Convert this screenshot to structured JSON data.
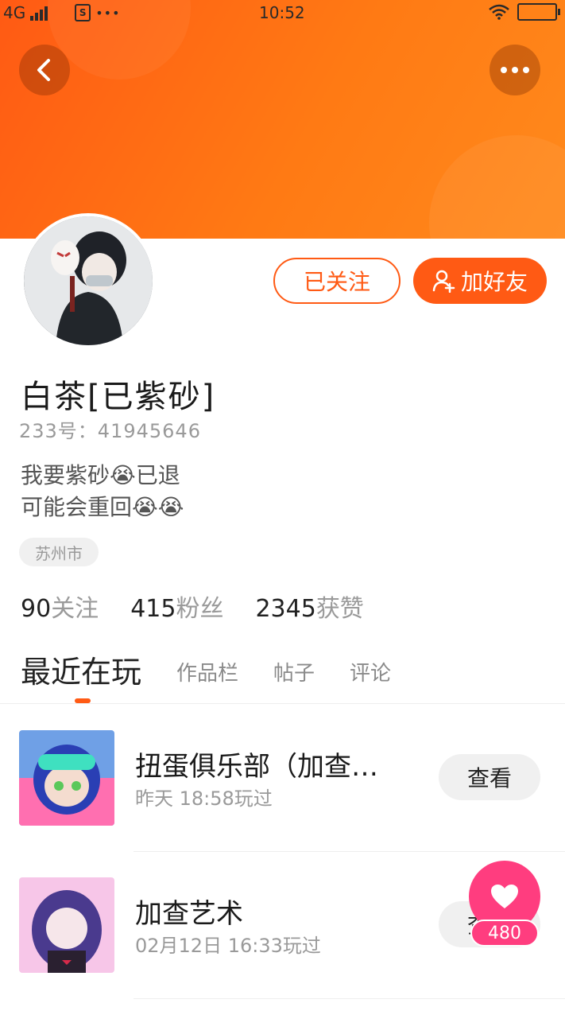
{
  "status_bar": {
    "network": "4G",
    "sim_label": "S",
    "more": "•••",
    "time": "10:52"
  },
  "colors": {
    "accent": "#ff5a14",
    "banner_start": "#ff5a14",
    "banner_end": "#ff8a1c",
    "favorite": "#ff3d7f"
  },
  "icons": {
    "back": "chevron-left-icon",
    "more": "more-dots-icon",
    "add_friend": "add-user-icon",
    "favorite": "heart-icon",
    "wifi": "wifi-icon",
    "battery": "battery-icon",
    "signal": "signal-icon"
  },
  "profile": {
    "name": "白茶[已紫砂]",
    "uid": "233号：41945646",
    "bio_line1": "我要紫砂😭已退",
    "bio_line2": "可能会重回😭😭",
    "location": "苏州市"
  },
  "actions": {
    "following_label": "已关注",
    "add_friend_label": "加好友"
  },
  "stats": {
    "following_count": "90",
    "following_label": "关注",
    "followers_count": "415",
    "followers_label": "粉丝",
    "likes_count": "2345",
    "likes_label": "获赞"
  },
  "tabs": {
    "recent": "最近在玩",
    "works": "作品栏",
    "posts": "帖子",
    "comments": "评论"
  },
  "games": [
    {
      "title": "扭蛋俱乐部（加查…",
      "played": "昨天 18:58玩过",
      "view_label": "查看"
    },
    {
      "title": "加查艺术",
      "played": "02月12日 16:33玩过",
      "view_label": "查看"
    }
  ],
  "favorite": {
    "count": "480"
  }
}
